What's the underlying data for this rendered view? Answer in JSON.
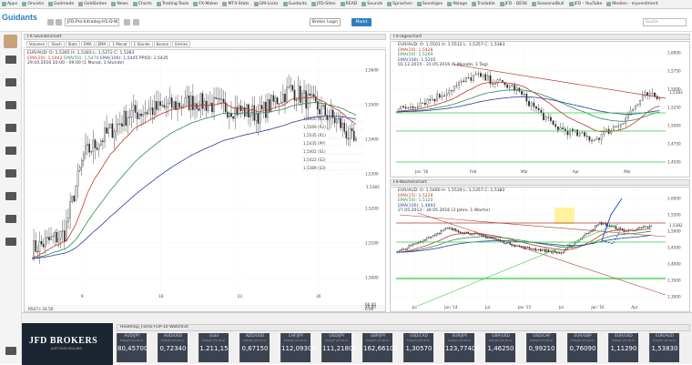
{
  "bookmarks": [
    "Apps",
    "Onvista",
    "Godmode",
    "GoldSeiten",
    "News",
    "Charts",
    "Trading-Tools",
    "FX-Maker",
    "MT4-Stats",
    "GM-Links",
    "Guidants",
    "JFD-Sites",
    "READ",
    "Sounds",
    "Sprachen",
    "Sonstiges",
    "Ablage",
    "Tradable",
    "JFD - DESK",
    "SeasonalBull",
    "JFD - YouTube",
    "Medien - myvestment"
  ],
  "app": {
    "logo": "Guidants",
    "workspace_select": "JFD-Pro-Intraday-H1-D-W",
    "broker_login": "Broker Login",
    "market": "Markt",
    "search_placeholder": "Suche"
  },
  "left_panel": {
    "title": "FX-Stundenchart",
    "toolbar": [
      "Volumen",
      "Stoch",
      "Stats",
      "EMA",
      "EMA",
      "1 Monat",
      "1 Stunde",
      "Kerzen",
      "Entries"
    ],
    "info": [
      "EUR/AUD: O: 1,5365  H: 1,5383  L: 1,5372  C: 1,5383",
      "EMA(20): 1,5442",
      "EMA(50): 1,5470",
      "EMA(100): 1,5445",
      "PP(D): 1,5435",
      "29.04.2016 20:00 - 09:00 (1 Monat, 1 Stunde)"
    ],
    "pivots": [
      "1,5600 (R3)",
      "1,5569 (R2)",
      "1,5535 (R1)",
      "1,5435 (PP)",
      "1,5402 (S1)",
      "1,5422 (S2)",
      "1,5389 (S3)"
    ],
    "yaxis": [
      "1,5600",
      "1,5500",
      "1,5400",
      "1,5300",
      "1,5200",
      "1,5100",
      "1,5000"
    ],
    "xaxis": [
      "9",
      "16",
      "23",
      "30"
    ],
    "price_badge": "1,5383",
    "sub_label": "RSI(7): 24.50",
    "sub_vals": [
      "60.00",
      "40.00",
      "0.00"
    ]
  },
  "top_right_panel": {
    "title": "FX-Tageschart",
    "info": [
      "EUR/AUD: O: 1,5501  H: 1,5512  L: 1,5357  C: 1,5383",
      "EMA(20): 1,5428",
      "EMA(50): 1,5269",
      "EMA(100): 1,5205",
      "01.12.2015 - 31.05.2016 (6 Monate, 1 Tag)"
    ],
    "yaxis": [
      "1,6000",
      "1,5750",
      "1,5500",
      "1,5250",
      "1,5000",
      "1,4750",
      "1,4500"
    ],
    "xaxis": [
      "Jan '16",
      "Feb",
      "Mär",
      "Apr",
      "Mai"
    ],
    "price_badge": "1,5383"
  },
  "bottom_right_panel": {
    "title": "FX-Wochenchart",
    "info": [
      "EUR/AUD: O: 1,5480  H: 1,5529  L: 1,5357  C: 1,5382",
      "EMA(25): 1,5228",
      "EMA(50): 1,5120",
      "EMA(100): 1,4893",
      "27.05.2013 - 30.05.2016 (3 Jahre, 1 Woche)"
    ],
    "yaxis": [
      "1,6000",
      "1,5500",
      "1,5000",
      "1,4500",
      "1,4000",
      "1,3500",
      "1,3000"
    ],
    "xaxis": [
      "Jul",
      "Jan '14",
      "Jul",
      "Jan '15",
      "Jul",
      "Jan '16",
      "Apr"
    ],
    "price_badge": "1,5382"
  },
  "bottom": {
    "brand": "JFD BROKERS",
    "tagline": "JUST FAIR DEALING",
    "heatmap_title": "Heatmap_Forex-TOP-10 Watchlist",
    "tickers": [
      {
        "name": "AUD/JPY",
        "price": "80,45700"
      },
      {
        "name": "AUD/USD",
        "price": "0,72340"
      },
      {
        "name": "Gold",
        "price": "1.211,15"
      },
      {
        "name": "NZD/USD",
        "price": "0,67150"
      },
      {
        "name": "CHF/JPY",
        "price": "112,09300"
      },
      {
        "name": "USD/JPY",
        "price": "111,21800"
      },
      {
        "name": "GBP/JPY",
        "price": "162,66100"
      },
      {
        "name": "USD/CAD",
        "price": "1,30570"
      },
      {
        "name": "EUR/JPY",
        "price": "123,77400"
      },
      {
        "name": "GBP/USD",
        "price": "1,46250"
      },
      {
        "name": "USD/CHF",
        "price": "0,99210"
      },
      {
        "name": "EUR/GBP",
        "price": "0,76090"
      },
      {
        "name": "EUR/USD",
        "price": "1,11290"
      },
      {
        "name": "EUR/AUD",
        "price": "1,53830"
      }
    ],
    "ticker_src": "EUR/JPY JFD Brok."
  },
  "colors": {
    "ema20": "#c0392b",
    "ema50": "#2e8b57",
    "ema100": "#2c3e9a",
    "accent": "#2f7fbf",
    "jfd_bg": "#1c2633"
  }
}
